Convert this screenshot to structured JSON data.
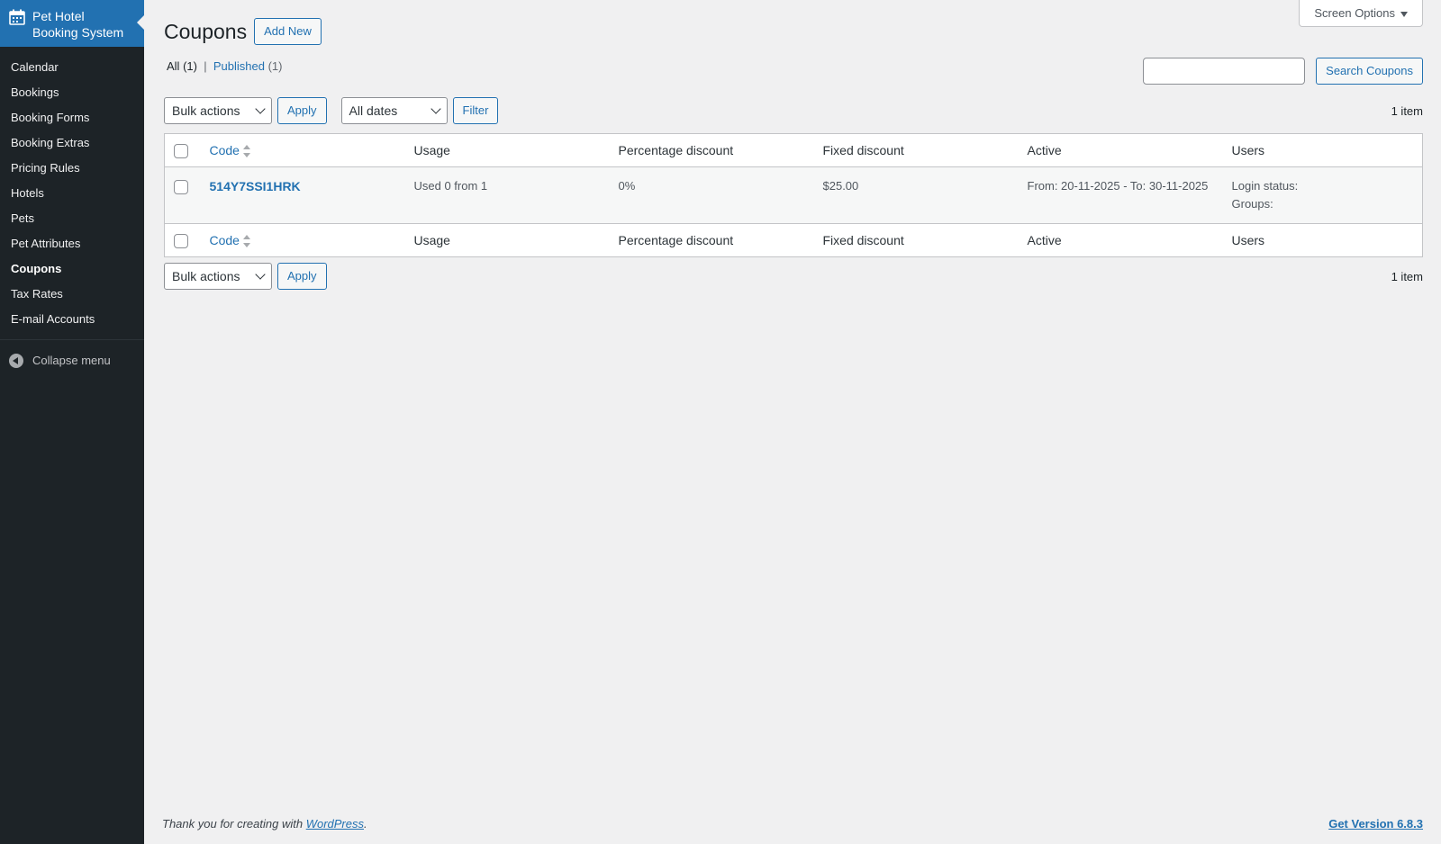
{
  "sidebar": {
    "brand_line1": "Pet Hotel",
    "brand_line2": "Booking System",
    "items": [
      {
        "label": "Calendar"
      },
      {
        "label": "Bookings"
      },
      {
        "label": "Booking Forms"
      },
      {
        "label": "Booking Extras"
      },
      {
        "label": "Pricing Rules"
      },
      {
        "label": "Hotels"
      },
      {
        "label": "Pets"
      },
      {
        "label": "Pet Attributes"
      },
      {
        "label": "Coupons"
      },
      {
        "label": "Tax Rates"
      },
      {
        "label": "E-mail Accounts"
      }
    ],
    "collapse_label": "Collapse menu"
  },
  "header": {
    "title": "Coupons",
    "add_new": "Add New",
    "screen_options": "Screen Options"
  },
  "views": {
    "all_label": "All",
    "all_count": "(1)",
    "separator": "|",
    "published_label": "Published",
    "published_count": "(1)"
  },
  "search": {
    "value": "",
    "button": "Search Coupons"
  },
  "top_nav": {
    "bulk_actions": "Bulk actions",
    "apply": "Apply",
    "dates": "All dates",
    "filter": "Filter",
    "count": "1 item"
  },
  "table": {
    "columns": [
      "Code",
      "Usage",
      "Percentage discount",
      "Fixed discount",
      "Active",
      "Users"
    ],
    "rows": [
      {
        "code": "514Y7SSI1HRK",
        "usage": "Used 0 from 1",
        "percentage": "0%",
        "fixed": "$25.00",
        "active": "From: 20-11-2025 - To: 30-11-2025",
        "users_line1": "Login status:",
        "users_line2": "Groups:"
      }
    ]
  },
  "bottom_nav": {
    "bulk_actions": "Bulk actions",
    "apply": "Apply",
    "count": "1 item"
  },
  "footer": {
    "thanks_prefix": "Thank you for creating with",
    "wordpress": "WordPress",
    "thanks_suffix": ".",
    "version": "Get Version 6.8.3"
  },
  "colors": {
    "accent": "#2271b1",
    "sidebar_bg": "#1d2327",
    "page_bg": "#f0f0f1"
  }
}
